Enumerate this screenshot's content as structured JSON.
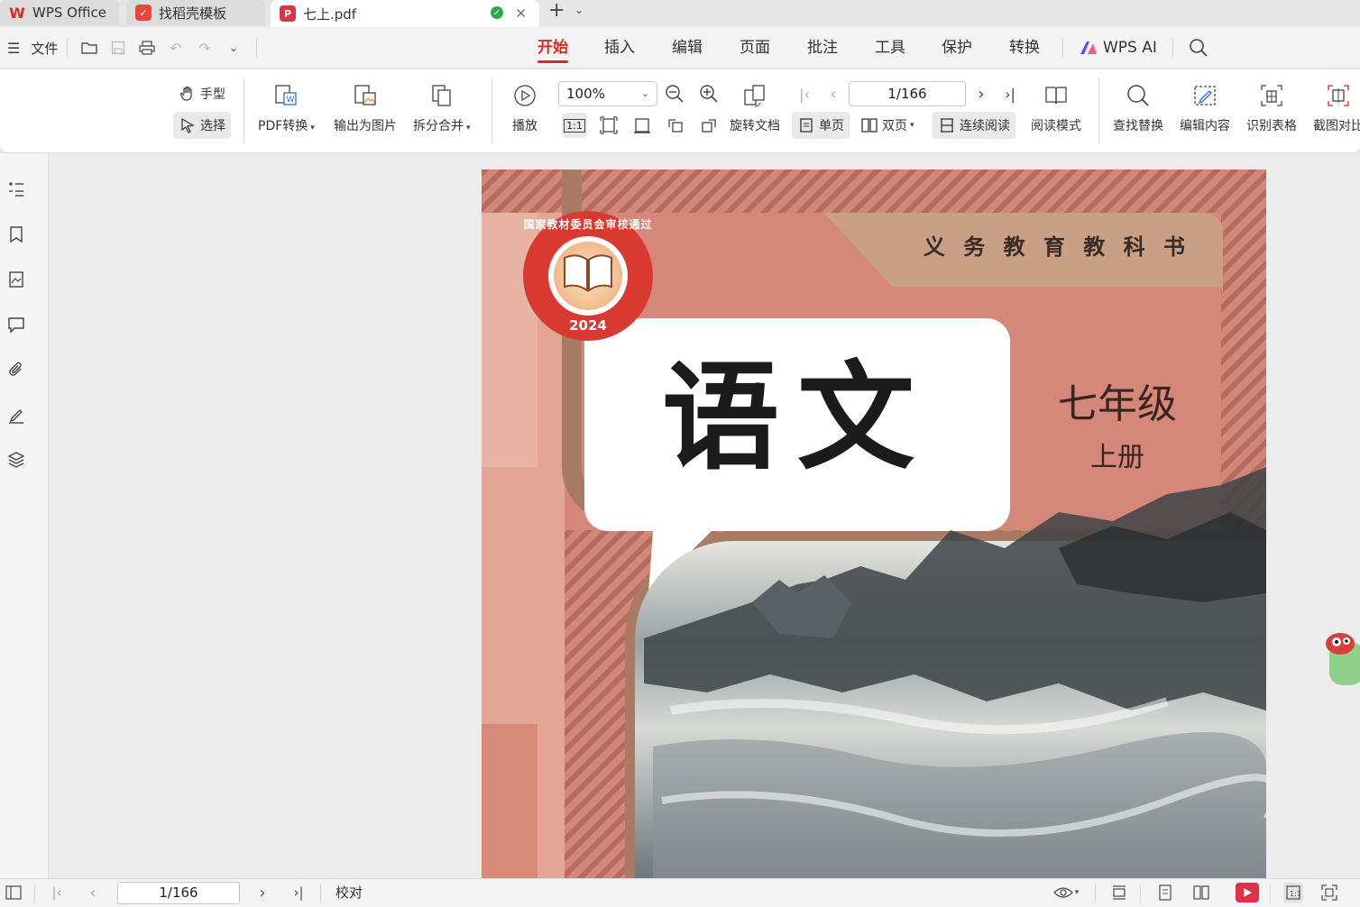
{
  "tabs": [
    {
      "label": "WPS Office",
      "icon": "wps-logo-icon"
    },
    {
      "label": "找稻壳模板",
      "icon": "docer-icon"
    },
    {
      "label": "七上.pdf",
      "icon": "pdf-icon",
      "active": true
    }
  ],
  "menubar": {
    "file_label": "文件",
    "tabs": [
      "开始",
      "插入",
      "编辑",
      "页面",
      "批注",
      "工具",
      "保护",
      "转换"
    ],
    "active_tab": "开始",
    "ai_label": "WPS AI"
  },
  "ribbon": {
    "hand_label": "手型",
    "select_label": "选择",
    "pdf_convert_label": "PDF转换",
    "export_image_label": "输出为图片",
    "split_merge_label": "拆分合并",
    "play_label": "播放",
    "zoom_value": "100%",
    "actual_size_label": "1:1",
    "page_value": "1/166",
    "rotate_label": "旋转文档",
    "single_page_label": "单页",
    "double_page_label": "双页",
    "continuous_label": "连续阅读",
    "read_mode_label": "阅读模式",
    "find_replace_label": "查找替换",
    "edit_content_label": "编辑内容",
    "recognize_table_label": "识别表格",
    "screenshot_compare_label": "截图对比"
  },
  "cover": {
    "series": "义 务 教 育 教 科 书",
    "title": "语文",
    "grade": "七年级",
    "volume": "上册",
    "seal_text": "国家教材委员会审核通过",
    "seal_year": "2024"
  },
  "status": {
    "page_value": "1/166",
    "proof_label": "校对"
  },
  "colors": {
    "accent": "#d62a2a",
    "cover_salmon": "#c98377",
    "cover_pink": "#e3a595",
    "cover_brown": "#a97a64",
    "cover_tan": "#c7a085"
  }
}
